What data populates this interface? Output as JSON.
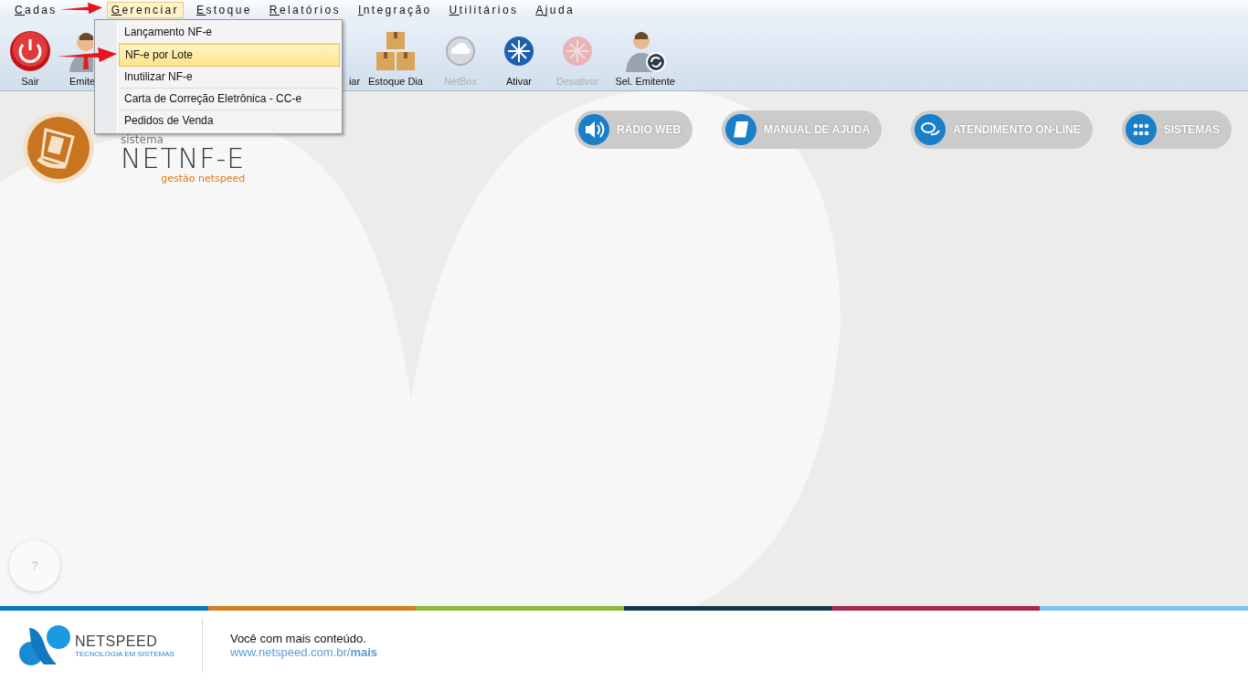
{
  "menu_bar": [
    {
      "label": "Cadas",
      "selected": false
    },
    {
      "label": "Gerenciar",
      "selected": true
    },
    {
      "label": "Estoque",
      "selected": false
    },
    {
      "label": "Relatórios",
      "selected": false
    },
    {
      "label": "Integração",
      "selected": false
    },
    {
      "label": "Utilitários",
      "selected": false
    },
    {
      "label": "Ajuda",
      "selected": false
    }
  ],
  "toolbar": [
    {
      "label": "Sair",
      "kind": "power",
      "disabled": false
    },
    {
      "label": "Emite",
      "kind": "person",
      "disabled": false
    },
    {
      "label": "iar",
      "kind": "hidden",
      "disabled": false
    },
    {
      "label": "Estoque Dia",
      "kind": "boxes",
      "disabled": false
    },
    {
      "label": "NetBox",
      "kind": "cloud",
      "disabled": true
    },
    {
      "label": "Ativar",
      "kind": "star",
      "disabled": false
    },
    {
      "label": "Desativar",
      "kind": "star",
      "disabled": true
    },
    {
      "label": "Sel. Emitente",
      "kind": "person-sync",
      "disabled": false
    }
  ],
  "dropdown": [
    {
      "label": "Lançamento NF-e",
      "selected": false
    },
    {
      "label": "NF-e por Lote",
      "selected": true
    },
    {
      "label": "Inutilizar NF-e",
      "selected": false
    },
    {
      "label": "Carta de Correção Eletrônica - CC-e",
      "selected": false
    },
    {
      "label": "Pedidos de Venda",
      "selected": false
    }
  ],
  "brand": {
    "caption": "sistema",
    "name": "NETNF-E",
    "tagline": "gestão netspeed"
  },
  "quick_buttons": [
    {
      "label": "RÁDIO WEB",
      "kind": "speaker"
    },
    {
      "label": "MANUAL DE AJUDA",
      "kind": "book"
    },
    {
      "label": "ATENDIMENTO ON-LINE",
      "kind": "chat"
    },
    {
      "label": "SISTEMAS",
      "kind": "grid"
    }
  ],
  "help_button": "?",
  "footer": {
    "logo_name": "NETSPEED",
    "logo_tagline": "TECNOLOGIA EM SISTEMAS",
    "slogan": "Você com mais conteúdo.",
    "link": "www.netspeed.com.br/**mais**"
  }
}
